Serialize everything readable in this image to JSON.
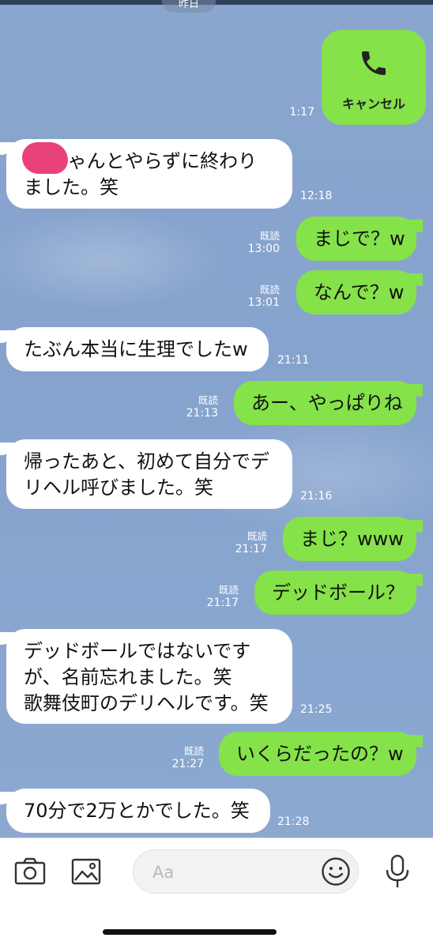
{
  "date_label": "昨日",
  "call": {
    "label": "キャンセル",
    "time": "1:17"
  },
  "messages": [
    {
      "dir": "in",
      "lines": [
        "　 ちゃんとやらずに終わり",
        "ました。笑"
      ],
      "time": "12:18"
    },
    {
      "dir": "out",
      "lines": [
        "まじで？w"
      ],
      "read": "既読",
      "time": "13:00"
    },
    {
      "dir": "out",
      "lines": [
        "なんで？w"
      ],
      "read": "既読",
      "time": "13:01"
    },
    {
      "dir": "in",
      "lines": [
        "たぶん本当に生理でしたw"
      ],
      "time": "21:11"
    },
    {
      "dir": "out",
      "lines": [
        "あー、やっぱりね"
      ],
      "read": "既読",
      "time": "21:13"
    },
    {
      "dir": "in",
      "lines": [
        "帰ったあと、初めて自分でデ",
        "リヘル呼びました。笑"
      ],
      "time": "21:16"
    },
    {
      "dir": "out",
      "lines": [
        "まじ？www"
      ],
      "read": "既読",
      "time": "21:17"
    },
    {
      "dir": "out",
      "lines": [
        "デッドボール？"
      ],
      "read": "既読",
      "time": "21:17"
    },
    {
      "dir": "in",
      "lines": [
        "デッドボールではないです",
        "が、名前忘れました。笑",
        "歌舞伎町のデリヘルです。笑"
      ],
      "time": "21:25"
    },
    {
      "dir": "out",
      "lines": [
        "いくらだったの？w"
      ],
      "read": "既読",
      "time": "21:27"
    },
    {
      "dir": "in",
      "lines": [
        "70分で2万とかでした。笑"
      ],
      "time": "21:28"
    }
  ],
  "input": {
    "placeholder": "Aa"
  },
  "icons": {
    "camera": "camera-icon",
    "image": "image-icon",
    "emoji": "emoji-icon",
    "mic": "microphone-icon",
    "phone": "phone-icon"
  },
  "colors": {
    "outgoing": "#85e249",
    "incoming": "#ffffff",
    "background": "#88a5cf"
  }
}
